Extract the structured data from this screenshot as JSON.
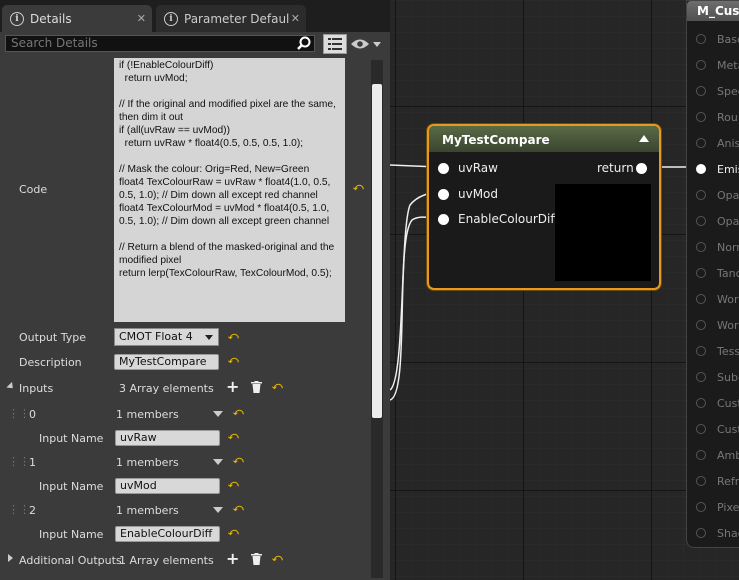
{
  "tabs": [
    {
      "label": "Details",
      "close": "✕"
    },
    {
      "label": "Parameter Defaults",
      "close": "✕"
    }
  ],
  "search": {
    "placeholder": "Search Details"
  },
  "details": {
    "code_label": "Code",
    "code_value": "if (!EnableColourDiff)\n  return uvMod;\n\n// If the original and modified pixel are the same, then dim it out\nif (all(uvRaw == uvMod))\n  return uvRaw * float4(0.5, 0.5, 0.5, 1.0);\n\n// Mask the colour: Orig=Red, New=Green\nfloat4 TexColourRaw = uvRaw * float4(1.0, 0.5, 0.5, 1.0); // Dim down all except red channel\nfloat4 TexColourMod = uvMod * float4(0.5, 1.0, 0.5, 1.0); // Dim down all except green channel\n\n// Return a blend of the masked-original and the modified pixel\nreturn lerp(TexColourRaw, TexColourMod, 0.5);",
    "output_type_label": "Output Type",
    "output_type_value": "CMOT Float 4",
    "description_label": "Description",
    "description_value": "MyTestCompare",
    "inputs_label": "Inputs",
    "inputs_count": "3 Array elements",
    "inputs": [
      {
        "index": "0",
        "members": "1 members",
        "name_label": "Input Name",
        "name_value": "uvRaw"
      },
      {
        "index": "1",
        "members": "1 members",
        "name_label": "Input Name",
        "name_value": "uvMod"
      },
      {
        "index": "2",
        "members": "1 members",
        "name_label": "Input Name",
        "name_value": "EnableColourDiff"
      }
    ],
    "additional_outputs_label": "Additional Outputs",
    "additional_outputs_count": "1 Array elements"
  },
  "node": {
    "title": "MyTestCompare",
    "inputs": [
      "uvRaw",
      "uvMod",
      "EnableColourDiff"
    ],
    "output": "return"
  },
  "material_node": {
    "title": "M_Cust",
    "pins": [
      "Base",
      "Meta",
      "Spec",
      "Rou",
      "Anis",
      "Emis",
      "Opa",
      "Opa",
      "Norm",
      "Tanc",
      "Worl",
      "Worl",
      "Tess",
      "Sub-",
      "Cust",
      "Cust",
      "Amb",
      "Refr",
      "Pixe",
      "Shac"
    ],
    "active_pin": "Emis"
  },
  "colors": {
    "accent": "#e89a1c",
    "reset_arrow": "#e3b400",
    "node_header": "#5a6a45"
  }
}
